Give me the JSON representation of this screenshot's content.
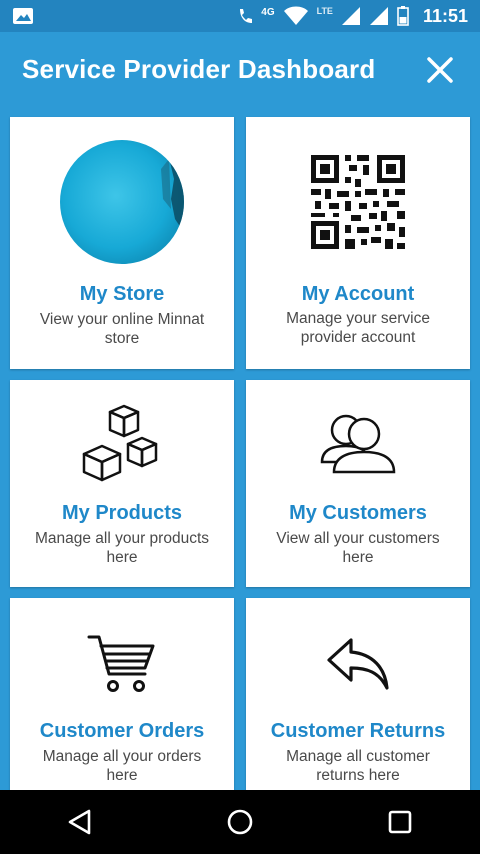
{
  "status_bar": {
    "network_label": "4G",
    "lte_label": "LTE",
    "time": "11:51"
  },
  "app_bar": {
    "title": "Service Provider Dashboard",
    "close_icon": "close-icon"
  },
  "cards": [
    {
      "title": "My Store",
      "description": "View your online Minnat store",
      "icon": "store-photo"
    },
    {
      "title": "My Account",
      "description": "Manage your service provider account",
      "icon": "qr-code-icon"
    },
    {
      "title": "My Products",
      "description": "Manage all your products here",
      "icon": "boxes-icon"
    },
    {
      "title": "My Customers",
      "description": "View all your customers here",
      "icon": "users-icon"
    },
    {
      "title": "Customer Orders",
      "description": "Manage all your orders here",
      "icon": "cart-icon"
    },
    {
      "title": "Customer Returns",
      "description": "Manage all customer returns here",
      "icon": "return-arrow-icon"
    }
  ],
  "nav": {
    "back": "back-icon",
    "home": "home-icon",
    "recents": "recents-icon"
  },
  "colors": {
    "primary": "#2d9ad6",
    "status_bar": "#2384bf",
    "title_blue": "#1f88c9"
  }
}
